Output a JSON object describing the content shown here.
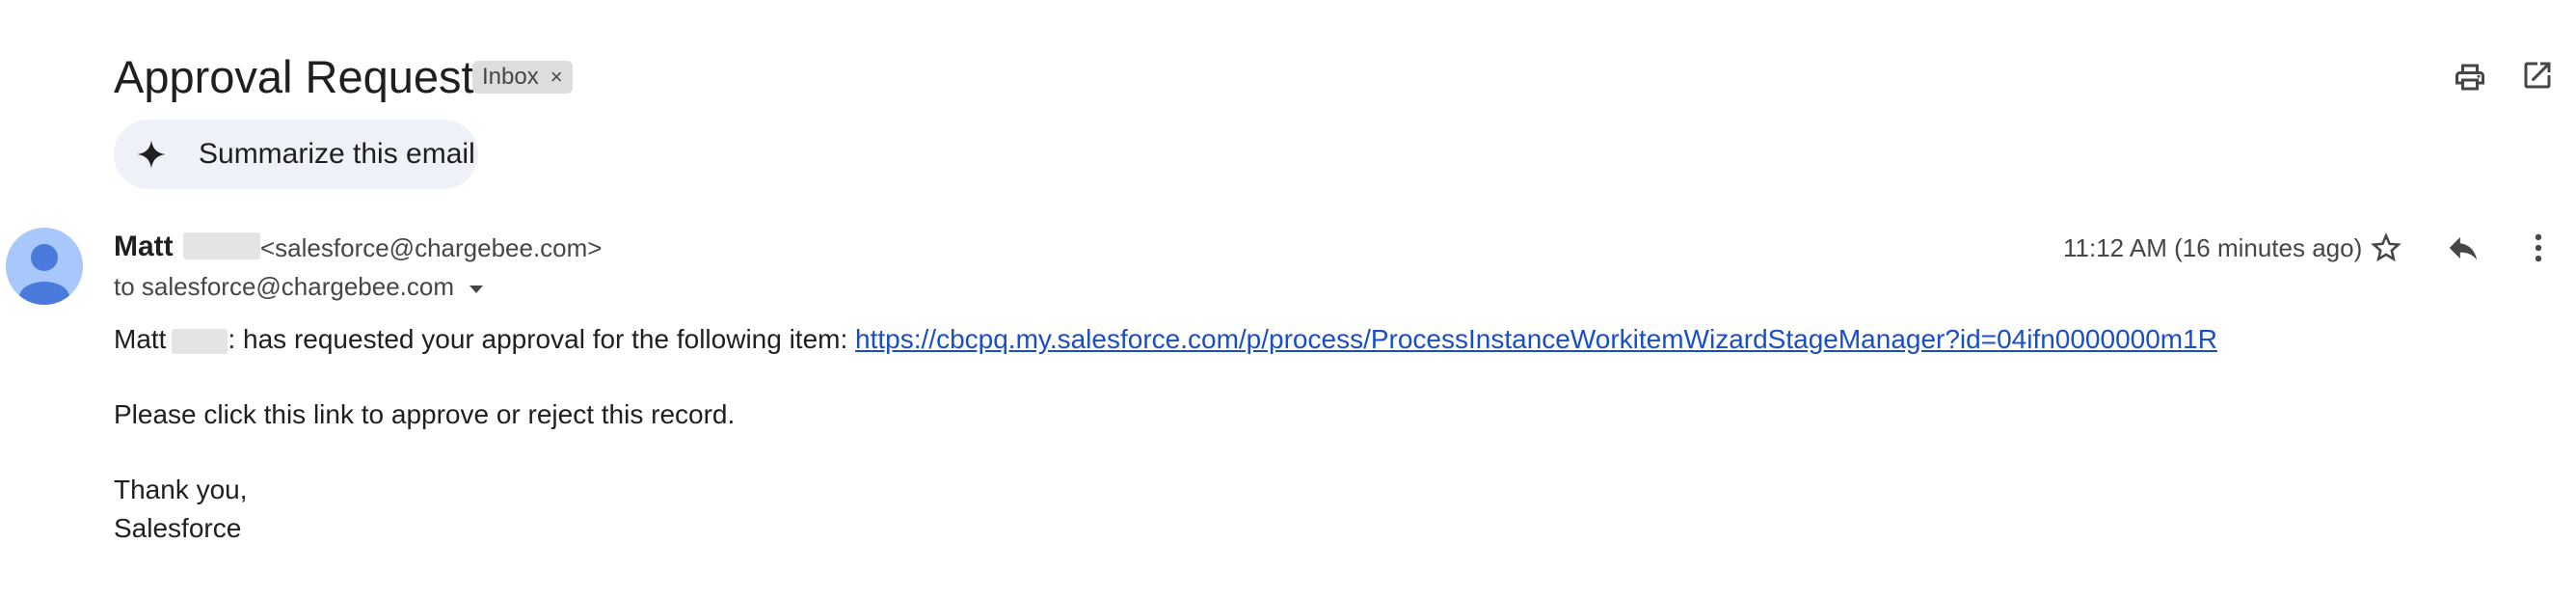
{
  "email": {
    "subject": "Approval Request",
    "label_chip": "Inbox",
    "label_chip_remove": "×",
    "summarize_label": "Summarize this email",
    "sender": {
      "name": "Matt",
      "email": "<salesforce@chargebee.com>",
      "to": "to salesforce@chargebee.com"
    },
    "timestamp": "11:12 AM (16 minutes ago)",
    "body": {
      "line1_name": "Matt",
      "line1_text": ": has requested your approval for the following item: ",
      "line1_link": "https://cbcpq.my.salesforce.com/p/process/ProcessInstanceWorkitemWizardStageManager?id=04ifn0000000m1R",
      "line2": "Please click this link to approve or reject this record.",
      "line3": "Thank you,",
      "line4": "Salesforce"
    }
  },
  "icons": {
    "print": "print-icon",
    "open_new_window": "open-in-new-icon",
    "sparkle": "sparkle-icon",
    "avatar": "person-icon",
    "star": "star-icon",
    "reply": "reply-icon",
    "more": "more-vert-icon",
    "caret": "caret-down-icon"
  },
  "colors": {
    "link": "#1a4fc3",
    "avatar_bg": "#a8c7fa",
    "avatar_fg": "#4a7bdc",
    "summarize_bg": "#eef1f7",
    "chip_bg": "#dddddd"
  }
}
